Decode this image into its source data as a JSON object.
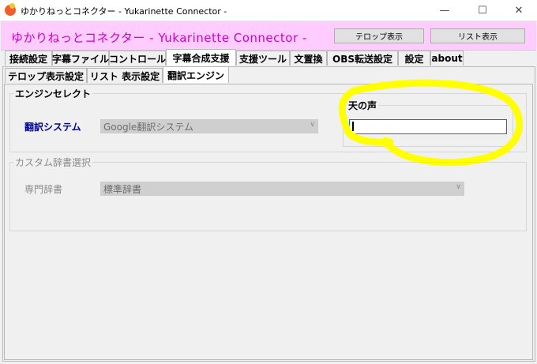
{
  "window": {
    "title": "ゆかりねっとコネクター - Yukarinette Connector -",
    "controls": {
      "minimize": "—",
      "maximize": "☐",
      "close": "✕"
    }
  },
  "header": {
    "title": "ゆかりねっとコネクター  - Yukarinette Connector -",
    "telop_button": "テロップ表示",
    "list_button": "リスト表示"
  },
  "main_tabs": [
    {
      "label": "接続設定"
    },
    {
      "label": "字幕ファイル"
    },
    {
      "label": "コントロール"
    },
    {
      "label": "字幕合成支援"
    },
    {
      "label": "支援ツール"
    },
    {
      "label": "文置換"
    },
    {
      "label": "OBS転送設定"
    },
    {
      "label": "設定"
    },
    {
      "label": "about"
    }
  ],
  "sub_tabs": [
    {
      "label": "テロップ表示設定"
    },
    {
      "label": "リスト 表示設定"
    },
    {
      "label": "翻訳エンジン"
    }
  ],
  "engine_group": {
    "label": "エンジンセレクト",
    "system_label": "翻訳システム",
    "system_value": "Google翻訳システム",
    "voice_label": "天の声",
    "voice_value": ""
  },
  "dict_group": {
    "label": "カスタム辞書選択",
    "dict_label": "専門辞書",
    "dict_value": "標準辞書"
  },
  "colors": {
    "header_bg": "#ffccff",
    "header_text": "#cc00cc",
    "link_blue": "#000099",
    "highlight": "#ffff00"
  }
}
